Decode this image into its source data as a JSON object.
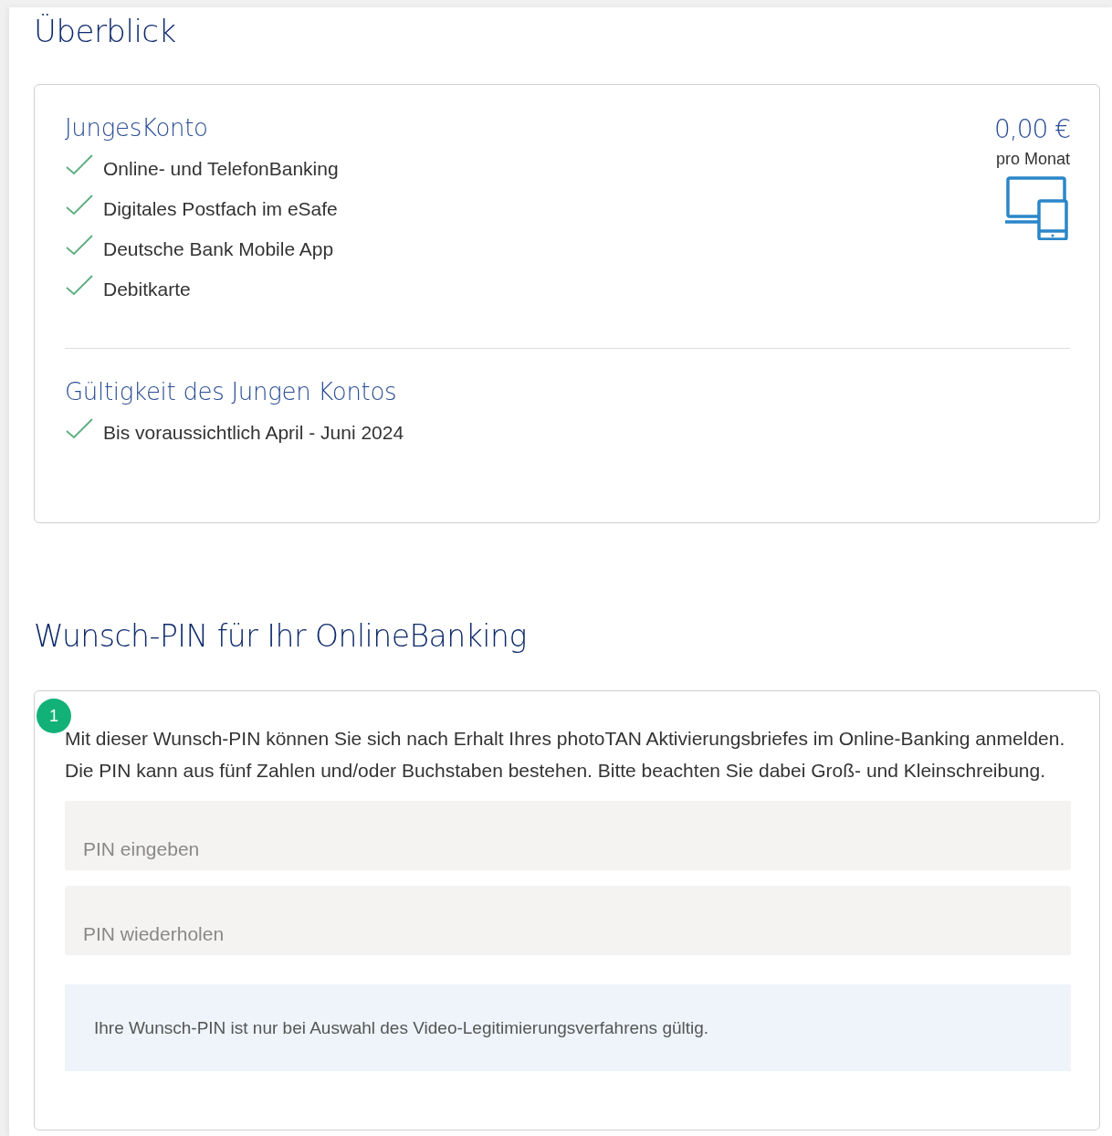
{
  "title": "Überblick",
  "account": {
    "name": "JungesKonto",
    "price": "0,00 €",
    "period": "pro Monat",
    "features": [
      "Online- und TelefonBanking",
      "Digitales Postfach im eSafe",
      "Deutsche Bank Mobile App",
      "Debitkarte"
    ],
    "validity_title": "Gültigkeit des Jungen Kontos",
    "validity": [
      "Bis voraussichtlich April - Juni 2024"
    ]
  },
  "pin_section": {
    "title": "Wunsch-PIN für Ihr OnlineBanking",
    "step": "1",
    "description": "Mit dieser Wunsch-PIN können Sie sich nach Erhalt Ihres photoTAN Aktivierungsbriefes im Online-Banking anmelden. Die PIN kann aus fünf Zahlen und/oder Buchstaben bestehen. Bitte beachten Sie dabei Groß- und Kleinschreibung.",
    "fields": [
      {
        "placeholder": "PIN eingeben"
      },
      {
        "placeholder": "PIN wiederholen"
      }
    ],
    "info": "Ihre Wunsch-PIN ist nur bei Auswahl des Video-Legitimierungsverfahrens gültig."
  }
}
